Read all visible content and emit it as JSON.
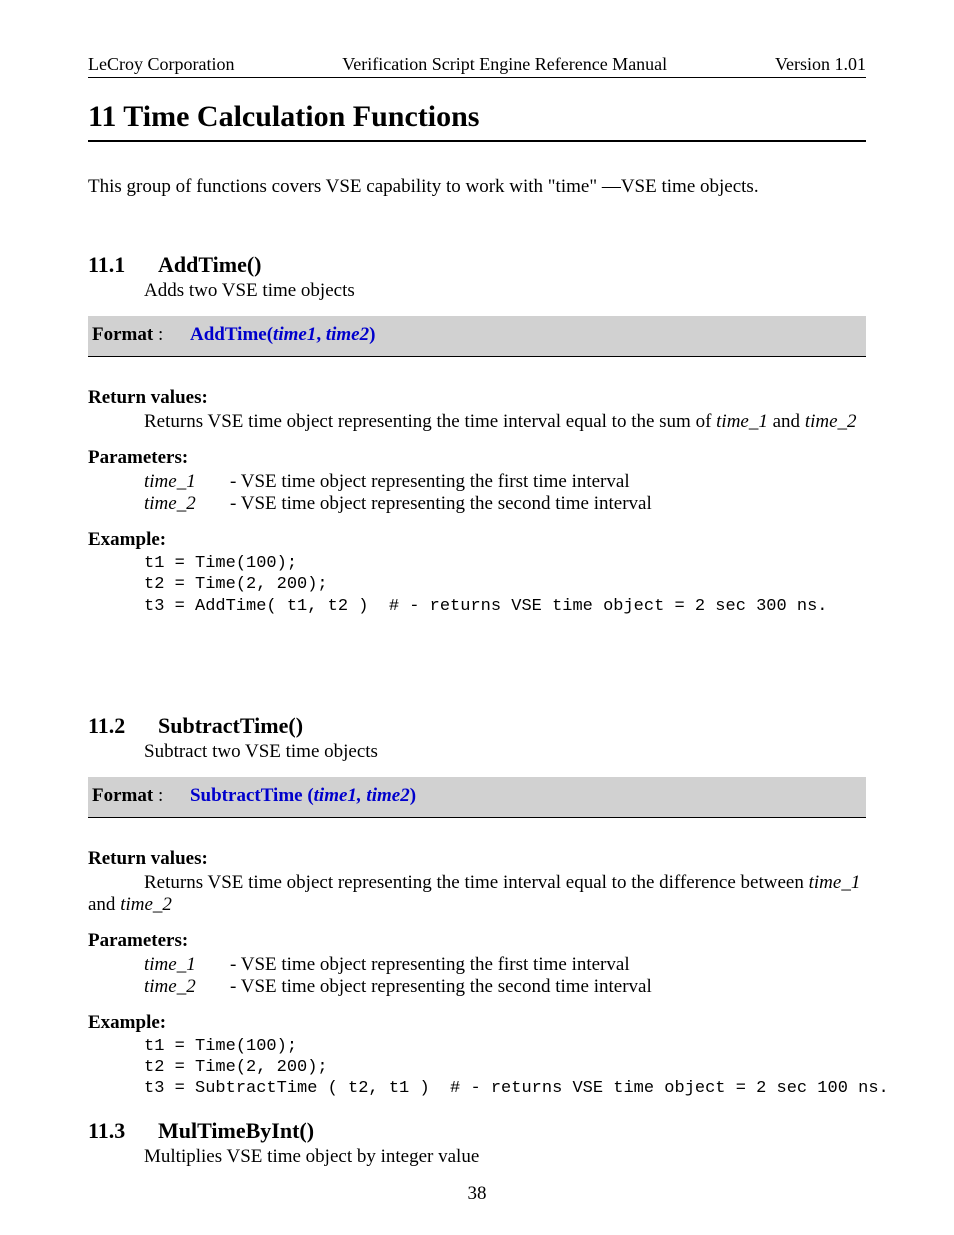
{
  "header": {
    "left": "LeCroy Corporation",
    "center": "Verification Script Engine Reference Manual",
    "right": "Version 1.01"
  },
  "chapter": {
    "title": "11  Time Calculation Functions",
    "intro": "This group of functions covers VSE capability to work with \"time\" —VSE time objects."
  },
  "s1": {
    "num": "11.1",
    "name": "AddTime()",
    "desc": "Adds two VSE time objects",
    "format_label": "Format",
    "format_fn": "AddTime(",
    "format_args": "time1",
    "format_sep": ", ",
    "format_args2": "time2",
    "format_close": ")",
    "ret_head": "Return values:",
    "ret_pre": "Returns VSE time object representing the time interval equal to the sum of ",
    "ret_v1": "time_1",
    "ret_mid": " and ",
    "ret_v2": "time_2",
    "par_head": "Parameters:",
    "p1_name": "time_1",
    "p1_desc": "-  VSE time object representing the first time interval",
    "p2_name": "time_2",
    "p2_desc": "-  VSE time object representing the second time interval",
    "ex_head": "Example:",
    "code": "t1 = Time(100);\nt2 = Time(2, 200);\nt3 = AddTime( t1, t2 )  # - returns VSE time object = 2 sec 300 ns."
  },
  "s2": {
    "num": "11.2",
    "name": "SubtractTime()",
    "desc": "Subtract two VSE time objects",
    "format_label": "Format",
    "format_fn": "SubtractTime (",
    "format_args": "time1, time2",
    "format_close": ")",
    "ret_head": "Return values:",
    "ret_pre": "Returns VSE time object representing the time interval equal to the difference between ",
    "ret_v1": "time_1",
    "ret_mid": " and ",
    "ret_v2": "time_2",
    "par_head": "Parameters:",
    "p1_name": "time_1",
    "p1_desc": "-  VSE time object representing the first time interval",
    "p2_name": "time_2",
    "p2_desc": "-  VSE time object representing the second time interval",
    "ex_head": "Example:",
    "code": "t1 = Time(100);\nt2 = Time(2, 200);\nt3 = SubtractTime ( t2, t1 )  # - returns VSE time object = 2 sec 100 ns."
  },
  "s3": {
    "num": "11.3",
    "name": "MulTimeByInt()",
    "desc": "Multiplies VSE time object by integer value"
  },
  "page_number": "38"
}
